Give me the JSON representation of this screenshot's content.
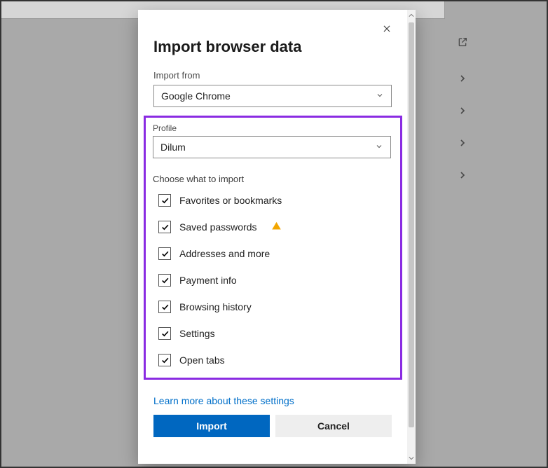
{
  "dialog": {
    "title": "Import browser data",
    "importFrom": {
      "label": "Import from",
      "selected": "Google Chrome"
    },
    "profile": {
      "label": "Profile",
      "selected": "Dilum"
    },
    "chooseLabel": "Choose what to import",
    "items": {
      "favorites": "Favorites or bookmarks",
      "passwords": "Saved passwords",
      "addresses": "Addresses and more",
      "payment": "Payment info",
      "history": "Browsing history",
      "settings": "Settings",
      "tabs": "Open tabs"
    },
    "learnMore": "Learn more about these settings",
    "buttons": {
      "import": "Import",
      "cancel": "Cancel"
    }
  }
}
